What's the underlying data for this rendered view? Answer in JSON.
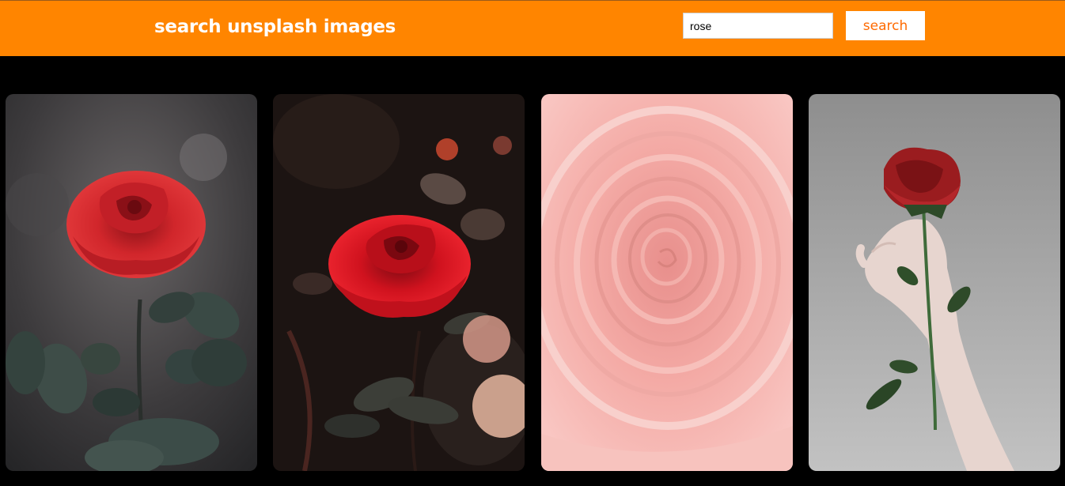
{
  "header": {
    "title": "search unsplash images",
    "background_color": "#ff8500",
    "search": {
      "value": "rose",
      "placeholder": ""
    },
    "search_button_label": "search",
    "search_button_color": "#ff6a00"
  },
  "gallery": {
    "images": [
      {
        "subject": "red rose with water droplets and leaves"
      },
      {
        "subject": "red rose in dark foliage"
      },
      {
        "subject": "close-up of pink rose petals"
      },
      {
        "subject": "hand holding a red rose"
      }
    ]
  }
}
